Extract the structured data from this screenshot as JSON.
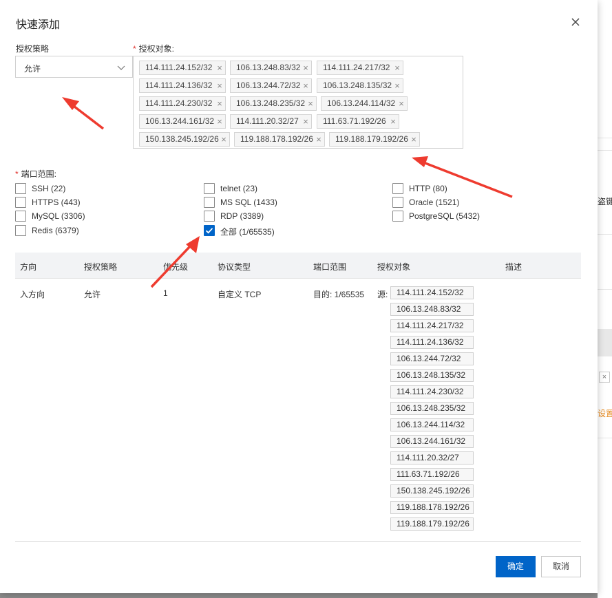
{
  "background_app": {
    "fragments": [
      "盗键",
      "设置"
    ]
  },
  "dialog": {
    "title": "快速添加",
    "policy": {
      "label": "授权策略",
      "value": "允许"
    },
    "objects": {
      "required_mark": "*",
      "label": "授权对象:",
      "tags": [
        "114.111.24.152/32",
        "106.13.248.83/32",
        "114.111.24.217/32",
        "114.111.24.136/32",
        "106.13.244.72/32",
        "106.13.248.135/32",
        "114.111.24.230/32",
        "106.13.248.235/32",
        "106.13.244.114/32",
        "106.13.244.161/32",
        "114.111.20.32/27",
        "111.63.71.192/26",
        "150.138.245.192/26",
        "119.188.178.192/26",
        "119.188.179.192/26"
      ]
    },
    "ports": {
      "required_mark": "*",
      "label": "端口范围:",
      "options": [
        {
          "label": "SSH (22)",
          "checked": false
        },
        {
          "label": "telnet (23)",
          "checked": false
        },
        {
          "label": "HTTP (80)",
          "checked": false
        },
        {
          "label": "HTTPS (443)",
          "checked": false
        },
        {
          "label": "MS SQL (1433)",
          "checked": false
        },
        {
          "label": "Oracle (1521)",
          "checked": false
        },
        {
          "label": "MySQL (3306)",
          "checked": false
        },
        {
          "label": "RDP (3389)",
          "checked": false
        },
        {
          "label": "PostgreSQL (5432)",
          "checked": false
        },
        {
          "label": "Redis (6379)",
          "checked": false
        },
        {
          "label": "全部 (1/65535)",
          "checked": true
        }
      ]
    },
    "table": {
      "headers": [
        "方向",
        "授权策略",
        "优先级",
        "协议类型",
        "端口范围",
        "授权对象",
        "描述"
      ],
      "row": {
        "direction": "入方向",
        "policy": "允许",
        "priority": "1",
        "protocol": "自定义 TCP",
        "port_range": "目的: 1/65535",
        "source_label": "源:",
        "sources": [
          "114.111.24.152/32",
          "106.13.248.83/32",
          "114.111.24.217/32",
          "114.111.24.136/32",
          "106.13.244.72/32",
          "106.13.248.135/32",
          "114.111.24.230/32",
          "106.13.248.235/32",
          "106.13.244.114/32",
          "106.13.244.161/32",
          "114.111.20.32/27",
          "111.63.71.192/26",
          "150.138.245.192/26",
          "119.188.178.192/26",
          "119.188.179.192/26"
        ],
        "description": ""
      }
    },
    "buttons": {
      "confirm": "确定",
      "cancel": "取消"
    }
  },
  "colors": {
    "primary": "#0064c8",
    "required": "#e0302a",
    "annotation_arrow": "#ee3b2f"
  }
}
